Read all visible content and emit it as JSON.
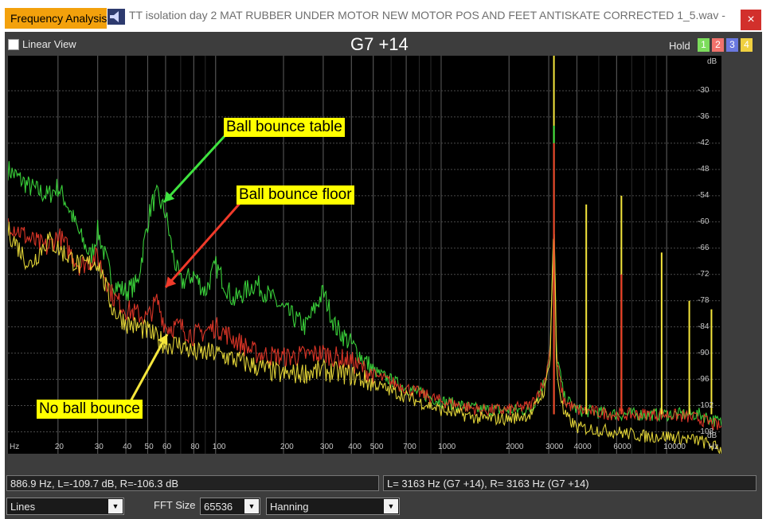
{
  "window": {
    "app_tab": "Frequency Analysis",
    "title": "TT isolation day 2 MAT RUBBER UNDER MOTOR  NEW MOTOR POS AND FEET ANTISKATE CORRECTED 1_5.wav -",
    "close_glyph": "×"
  },
  "toolbar": {
    "linear_view_label": "Linear View",
    "linear_view_checked": false,
    "note": "G7 +14",
    "hold_label": "Hold",
    "hold_buttons": [
      {
        "label": "1",
        "color": "#7cdc5c"
      },
      {
        "label": "2",
        "color": "#f0726c"
      },
      {
        "label": "3",
        "color": "#6a78e0"
      },
      {
        "label": "4",
        "color": "#f0d040"
      }
    ]
  },
  "chart_data": {
    "type": "line",
    "xscale": "log",
    "xunit": "Hz",
    "yunit": "dB",
    "xlim": [
      12,
      17500
    ],
    "ylim": [
      -113,
      -22
    ],
    "x_ticks": [
      "20",
      "30",
      "40",
      "50",
      "60",
      "80",
      "100",
      "200",
      "300",
      "400",
      "500",
      "700",
      "1000",
      "2000",
      "3000",
      "4000",
      "6000",
      "10000"
    ],
    "y_ticks": [
      "-30",
      "-36",
      "-42",
      "-48",
      "-54",
      "-60",
      "-66",
      "-72",
      "-78",
      "-84",
      "-90",
      "-96",
      "-102",
      "-108"
    ],
    "series": [
      {
        "color": "#3fe33f",
        "points": [
          [
            12,
            -48
          ],
          [
            15,
            -52
          ],
          [
            18,
            -54
          ],
          [
            20,
            -52
          ],
          [
            22,
            -56
          ],
          [
            25,
            -63
          ],
          [
            28,
            -68
          ],
          [
            30,
            -62
          ],
          [
            35,
            -74
          ],
          [
            40,
            -76
          ],
          [
            45,
            -74
          ],
          [
            50,
            -60
          ],
          [
            52,
            -56
          ],
          [
            55,
            -54
          ],
          [
            60,
            -58
          ],
          [
            65,
            -68
          ],
          [
            70,
            -74
          ],
          [
            80,
            -72
          ],
          [
            90,
            -76
          ],
          [
            100,
            -70
          ],
          [
            120,
            -78
          ],
          [
            150,
            -74
          ],
          [
            200,
            -80
          ],
          [
            250,
            -84
          ],
          [
            300,
            -76
          ],
          [
            340,
            -84
          ],
          [
            400,
            -88
          ],
          [
            500,
            -94
          ],
          [
            700,
            -98
          ],
          [
            1000,
            -101
          ],
          [
            1500,
            -103
          ],
          [
            2000,
            -103
          ],
          [
            2500,
            -103
          ],
          [
            2900,
            -96
          ],
          [
            3050,
            -88
          ],
          [
            3163,
            -60
          ],
          [
            3250,
            -90
          ],
          [
            3500,
            -100
          ],
          [
            4000,
            -103
          ],
          [
            6000,
            -104
          ],
          [
            8000,
            -104
          ],
          [
            10000,
            -104
          ],
          [
            14000,
            -104
          ],
          [
            17500,
            -106
          ]
        ]
      },
      {
        "color": "#f03a2a",
        "points": [
          [
            12,
            -60
          ],
          [
            15,
            -64
          ],
          [
            18,
            -66
          ],
          [
            20,
            -63
          ],
          [
            25,
            -70
          ],
          [
            30,
            -68
          ],
          [
            35,
            -77
          ],
          [
            40,
            -80
          ],
          [
            50,
            -82
          ],
          [
            55,
            -78
          ],
          [
            60,
            -84
          ],
          [
            70,
            -84
          ],
          [
            80,
            -86
          ],
          [
            100,
            -84
          ],
          [
            150,
            -90
          ],
          [
            200,
            -91
          ],
          [
            300,
            -90
          ],
          [
            400,
            -92
          ],
          [
            500,
            -95
          ],
          [
            700,
            -98
          ],
          [
            1000,
            -101
          ],
          [
            1500,
            -103
          ],
          [
            2000,
            -103
          ],
          [
            2500,
            -102
          ],
          [
            2900,
            -96
          ],
          [
            3050,
            -88
          ],
          [
            3163,
            -62
          ],
          [
            3250,
            -92
          ],
          [
            3500,
            -101
          ],
          [
            4000,
            -103
          ],
          [
            6000,
            -104
          ],
          [
            8000,
            -104
          ],
          [
            10000,
            -104
          ],
          [
            14000,
            -105
          ],
          [
            17500,
            -107
          ]
        ]
      },
      {
        "color": "#f5e63c",
        "points": [
          [
            12,
            -62
          ],
          [
            15,
            -70
          ],
          [
            18,
            -64
          ],
          [
            20,
            -66
          ],
          [
            25,
            -70
          ],
          [
            30,
            -69
          ],
          [
            35,
            -80
          ],
          [
            40,
            -83
          ],
          [
            50,
            -85
          ],
          [
            60,
            -88
          ],
          [
            70,
            -88
          ],
          [
            80,
            -90
          ],
          [
            100,
            -90
          ],
          [
            150,
            -93
          ],
          [
            200,
            -95
          ],
          [
            300,
            -94
          ],
          [
            400,
            -95
          ],
          [
            500,
            -97
          ],
          [
            700,
            -100
          ],
          [
            1000,
            -103
          ],
          [
            1500,
            -105
          ],
          [
            2000,
            -105
          ],
          [
            2500,
            -104
          ],
          [
            2900,
            -98
          ],
          [
            3050,
            -90
          ],
          [
            3163,
            -58
          ],
          [
            3250,
            -94
          ],
          [
            3500,
            -104
          ],
          [
            4000,
            -107
          ],
          [
            6000,
            -108
          ],
          [
            8000,
            -109
          ],
          [
            10000,
            -109
          ],
          [
            14000,
            -110
          ],
          [
            17500,
            -112
          ]
        ]
      }
    ],
    "peaks": [
      {
        "x": 3163,
        "y": -22,
        "color": "#f5e63c"
      },
      {
        "x": 3163,
        "y": -38,
        "color": "#3fe33f"
      },
      {
        "x": 3163,
        "y": -42,
        "color": "#f03a2a"
      },
      {
        "x": 4400,
        "y": -56,
        "color": "#f5e63c"
      },
      {
        "x": 6300,
        "y": -54,
        "color": "#f5e63c"
      },
      {
        "x": 6300,
        "y": -72,
        "color": "#f03a2a"
      },
      {
        "x": 9500,
        "y": -67,
        "color": "#f5e63c"
      },
      {
        "x": 12600,
        "y": -78,
        "color": "#f5e63c"
      },
      {
        "x": 15800,
        "y": -80,
        "color": "#f5e63c"
      }
    ],
    "annotations": [
      {
        "text": "Ball bounce table",
        "color": "#3fe33f"
      },
      {
        "text": "Ball bounce floor",
        "color": "#f03a2a"
      },
      {
        "text": "No ball bounce",
        "color": "#f5e63c"
      }
    ]
  },
  "status": {
    "cursor_readout": "886.9 Hz, L=-109.7 dB, R=-106.3 dB",
    "peak_readout": "L=   3163 Hz (G7 +14), R=   3163 Hz (G7 +14)"
  },
  "controls": {
    "display_mode": "Lines",
    "fft_size_label": "FFT Size",
    "fft_size": "65536",
    "window": "Hanning",
    "dropdown_glyph": "▼"
  }
}
